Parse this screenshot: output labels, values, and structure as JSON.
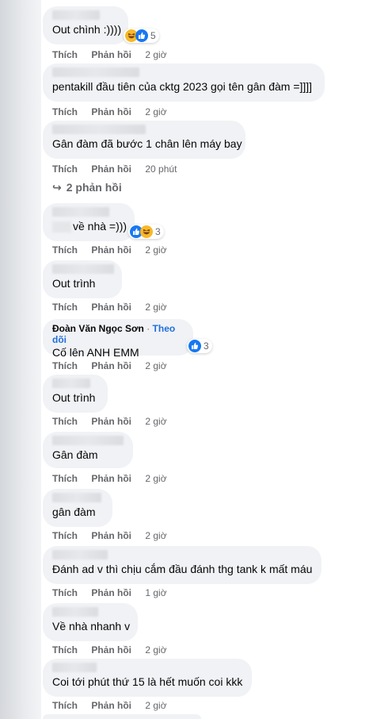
{
  "actions": {
    "like": "Thích",
    "reply": "Phản hồi"
  },
  "comments": [
    {
      "text": "Out chình :))))",
      "time": "2 giờ",
      "reaction_count": "5",
      "reactions": [
        "haha-icon",
        "like-icon"
      ]
    },
    {
      "text": "pentakill đầu tiên của cktg 2023 gọi tên gân đàm =]]]]",
      "time": "2 giờ"
    },
    {
      "text": "Gân đàm đã bước 1 chân lên máy bay",
      "time": "20 phút"
    },
    {
      "text": "về nhà =)))",
      "time": "2 giờ",
      "reaction_count": "3",
      "reactions": [
        "like-icon",
        "haha-icon"
      ]
    },
    {
      "text": "Out trình",
      "time": "2 giờ"
    },
    {
      "author": "Đoàn Văn Ngọc Sơn",
      "follow": "Theo dõi",
      "text": "Cố lên ANH EMM",
      "time": "2 giờ",
      "reaction_count": "3",
      "reactions": [
        "like-icon"
      ]
    },
    {
      "text": "Out trình",
      "time": "2 giờ"
    },
    {
      "text": "Gân đàm",
      "time": "2 giờ"
    },
    {
      "text": "gân đàm",
      "time": "2 giờ"
    },
    {
      "text": "Đánh ad v thì chịu cắm đầu đánh thg tank k mất máu",
      "time": "1 giờ"
    },
    {
      "text": "Về nhà nhanh v",
      "time": "2 giờ"
    },
    {
      "text": "Coi tới phút thứ 15 là hết muốn coi kkk",
      "time": "2 giờ"
    }
  ],
  "view_replies": "2 phản hồi",
  "colors": {
    "bubble": "#f0f2f5",
    "meta_text": "#65676b",
    "follow_link": "#216fdb",
    "like_blue": "#1877f2",
    "haha_yellow": "#f7b928"
  }
}
